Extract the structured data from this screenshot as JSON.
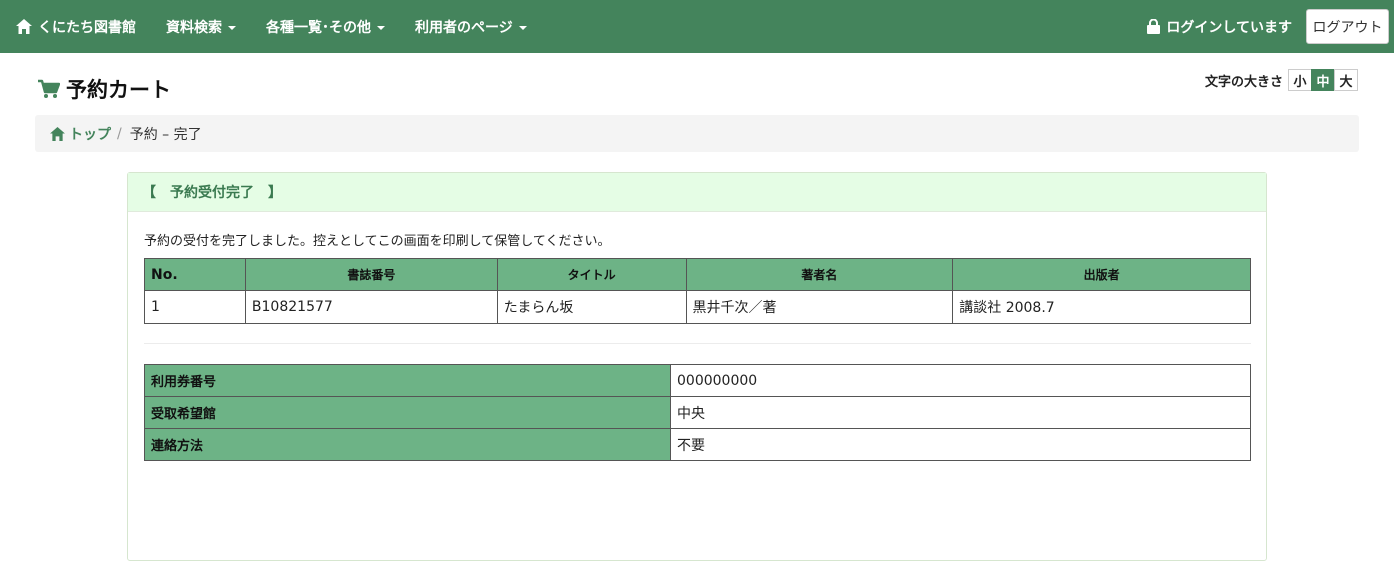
{
  "navbar": {
    "brand": "くにたち図書館",
    "items": [
      {
        "label": "資料検索"
      },
      {
        "label": "各種一覧･その他"
      },
      {
        "label": "利用者のページ"
      }
    ],
    "login_status": "ログインしています",
    "logout_label": "ログアウト"
  },
  "page": {
    "title": "予約カート"
  },
  "font_size": {
    "label": "文字の大きさ",
    "small": "小",
    "medium": "中",
    "large": "大",
    "selected": "中"
  },
  "breadcrumb": {
    "home": "トップ",
    "separator": "/",
    "current": "予約 – 完了"
  },
  "panel": {
    "heading": "【　予約受付完了　】",
    "message": "予約の受付を完了しました。控えとしてこの画面を印刷して保管してください。",
    "result_table": {
      "headers": {
        "no": "No.",
        "id": "書誌番号",
        "title": "タイトル",
        "author": "著者名",
        "publisher": "出版者"
      },
      "rows": [
        {
          "no": "1",
          "id": "B10821577",
          "title": "たまらん坂",
          "author": "黒井千次／著",
          "publisher": "講談社 2008.7"
        }
      ]
    },
    "info_table": {
      "card_label": "利用券番号",
      "card_value": "000000000",
      "pickup_label": "受取希望館",
      "pickup_value": "中央",
      "contact_label": "連絡方法",
      "contact_value": "不要"
    }
  },
  "colors": {
    "navbar": "#44845c",
    "table_header": "#6db386",
    "panel_heading": "#e5fde5"
  }
}
